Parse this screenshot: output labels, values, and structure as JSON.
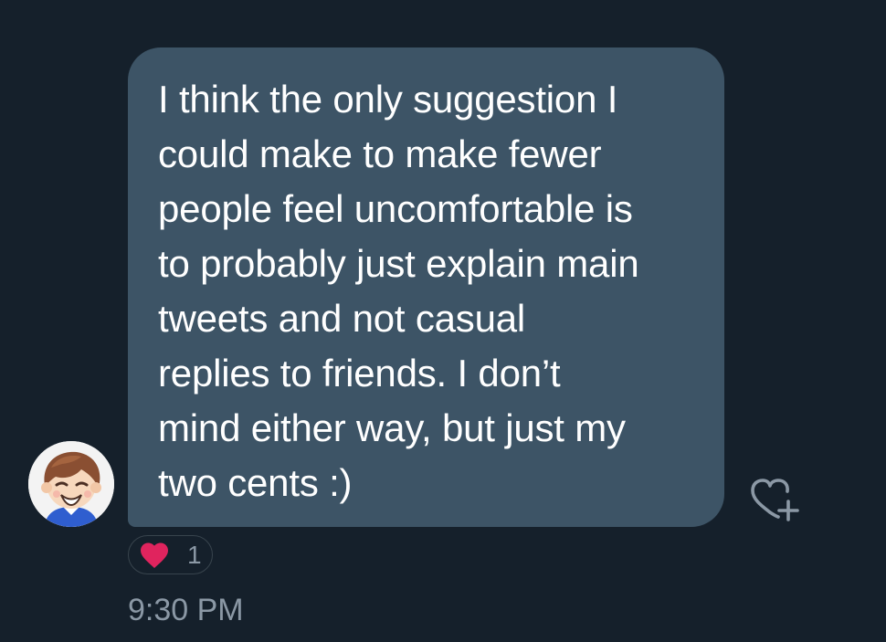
{
  "message": {
    "text": "I think the only suggestion I\ncould make to make fewer\npeople feel uncomfortable is\nto probably just explain main\ntweets and not casual\nreplies to friends. I don’t\nmind either way, but just my\ntwo cents :)",
    "timestamp": "9:30 PM"
  },
  "reaction": {
    "icon": "heart-icon",
    "count": "1"
  },
  "actions": {
    "add_reaction_icon": "heart-plus-icon"
  },
  "colors": {
    "background": "#15202b",
    "bubble": "#3d5466",
    "text": "#ffffff",
    "muted": "#8b98a5",
    "heart": "#e0245e"
  }
}
